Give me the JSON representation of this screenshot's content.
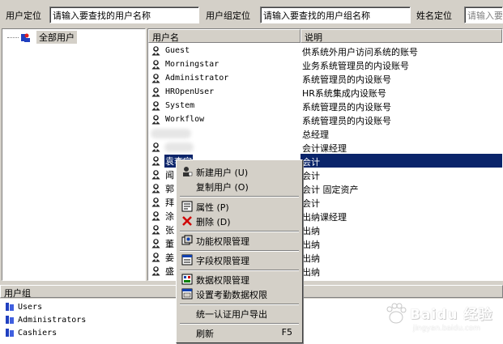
{
  "search": {
    "user_label": "用户定位",
    "user_placeholder": "请输入要查找的用户名称",
    "group_label": "用户组定位",
    "group_placeholder": "请输入要查找的用户组名称",
    "name_label": "姓名定位",
    "name_placeholder": "请输入要"
  },
  "tree": {
    "root_label": "全部用户"
  },
  "list": {
    "columns": [
      "用户名",
      "说明"
    ],
    "rows": [
      {
        "name": "Guest",
        "desc": "供系统外用户访问系统的账号"
      },
      {
        "name": "Morningstar",
        "desc": "业务系统管理员的内设账号"
      },
      {
        "name": "Administrator",
        "desc": "系统管理员的内设账号"
      },
      {
        "name": "HROpenUser",
        "desc": "HR系统集成内设账号"
      },
      {
        "name": "System",
        "desc": "系统管理员的内设账号"
      },
      {
        "name": "Workflow",
        "desc": "系统管理员的内设账号"
      },
      {
        "name": "",
        "desc": "总经理"
      },
      {
        "name": "",
        "desc": "会计课经理"
      },
      {
        "name": "袁李宇",
        "desc": "会计"
      },
      {
        "name": "闻",
        "desc": "会计"
      },
      {
        "name": "郭",
        "desc": "会计 固定资产"
      },
      {
        "name": "拜",
        "desc": "会计"
      },
      {
        "name": "涂",
        "desc": "出纳课经理"
      },
      {
        "name": "张",
        "desc": "出纳"
      },
      {
        "name": "董",
        "desc": "出纳"
      },
      {
        "name": "姜",
        "desc": "出纳"
      },
      {
        "name": "盛",
        "desc": "出纳"
      }
    ]
  },
  "groups": {
    "header": "用户组",
    "items": [
      "Users",
      "Administrators",
      "Cashiers"
    ]
  },
  "menu": {
    "new_user": "新建用户 (U)",
    "copy_user": "复制用户 (O)",
    "properties": "属性 (P)",
    "delete": "删除 (D)",
    "func_perm": "功能权限管理",
    "field_perm": "字段权限管理",
    "data_perm": "数据权限管理",
    "attendance_perm": "设置考勤数据权限",
    "export": "统一认证用户导出",
    "refresh": "刷新",
    "refresh_shortcut": "F5"
  },
  "watermark": {
    "brand": "Baidu 经验",
    "sub": "jingyan.baidu.com"
  },
  "colors": {
    "selection": "#0a246a",
    "face": "#d4d0c8"
  }
}
